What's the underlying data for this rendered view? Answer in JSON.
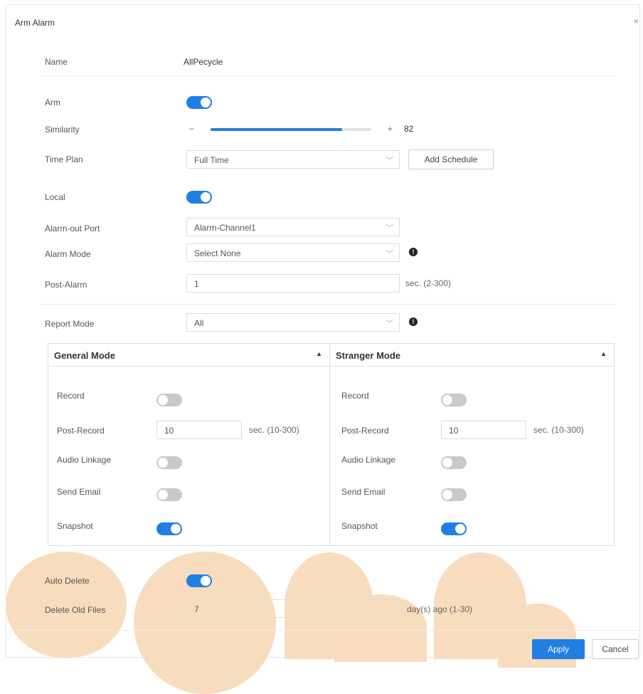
{
  "dialog": {
    "title": "Arm Alarm",
    "close": "×"
  },
  "name": {
    "label": "Name",
    "value": "AllPecycle"
  },
  "arm": {
    "label": "Arm",
    "on": true
  },
  "similarity": {
    "label": "Similarity",
    "minus": "−",
    "plus": "+",
    "value": "82",
    "percent": 82
  },
  "time_plan": {
    "label": "Time Plan",
    "value": "Full Time",
    "button": "Add Schedule"
  },
  "local": {
    "label": "Local",
    "on": true
  },
  "alarm_out_port": {
    "label": "Alarm-out Port",
    "value": "Alarm-Channel1"
  },
  "alarm_mode": {
    "label": "Alarm Mode",
    "value": "Select None",
    "info": "!"
  },
  "post_alarm": {
    "label": "Post-Alarm",
    "value": "1",
    "unit": "sec. (2-300)"
  },
  "report_mode": {
    "label": "Report Mode",
    "value": "All",
    "info": "!"
  },
  "general_mode": {
    "title": "General Mode",
    "caret": "▲",
    "record_label": "Record",
    "record_on": false,
    "post_record_label": "Post-Record",
    "post_record_value": "10",
    "post_record_unit": "sec. (10-300)",
    "audio_label": "Audio Linkage",
    "audio_on": false,
    "email_label": "Send Email",
    "email_on": false,
    "snapshot_label": "Snapshot",
    "snapshot_on": true
  },
  "stranger_mode": {
    "title": "Stranger Mode",
    "caret": "▲",
    "record_label": "Record",
    "record_on": false,
    "post_record_label": "Post-Record",
    "post_record_value": "10",
    "post_record_unit": "sec. (10-300)",
    "audio_label": "Audio Linkage",
    "audio_on": false,
    "email_label": "Send Email",
    "email_on": false,
    "snapshot_label": "Snapshot",
    "snapshot_on": true
  },
  "auto_delete": {
    "label": "Auto Delete",
    "on": true
  },
  "delete_old_files": {
    "label": "Delete Old Files",
    "value": "7",
    "unit": "day(s) ago (1-30)"
  },
  "footer": {
    "apply": "Apply",
    "cancel": "Cancel"
  },
  "colors": {
    "accent": "#1f7fe3",
    "toggle_off": "#c9c9c9",
    "overlay": "#f8dcbe"
  }
}
